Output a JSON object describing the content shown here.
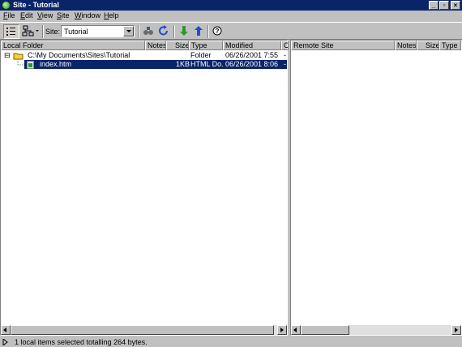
{
  "window": {
    "title": "Site - Tutorial"
  },
  "menu": [
    "File",
    "Edit",
    "View",
    "Site",
    "Window",
    "Help"
  ],
  "toolbar": {
    "site_label": "Site:",
    "site_value": "Tutorial"
  },
  "local": {
    "columns": [
      "Local Folder",
      "Notes",
      "Size",
      "Type",
      "Modified",
      "C"
    ],
    "rows": [
      {
        "name": "C:\\My Documents\\Sites\\Tutorial",
        "notes": "",
        "size": "",
        "type": "Folder",
        "modified": "06/26/2001 7:55 ...",
        "extra": "-",
        "expander": "⊟"
      },
      {
        "name": "index.htm",
        "notes": "",
        "size": "1KB",
        "type": "HTML Do...",
        "modified": "06/26/2001 8:06 ...",
        "extra": "-"
      }
    ]
  },
  "remote": {
    "columns": [
      "Remote Site",
      "Notes",
      "Size",
      "Type"
    ]
  },
  "status": {
    "text": "1 local items selected totalling 264 bytes."
  },
  "colors": {
    "titlebar": "#0a246a",
    "selection": "#0a246a",
    "chrome": "#c0c0c0"
  }
}
